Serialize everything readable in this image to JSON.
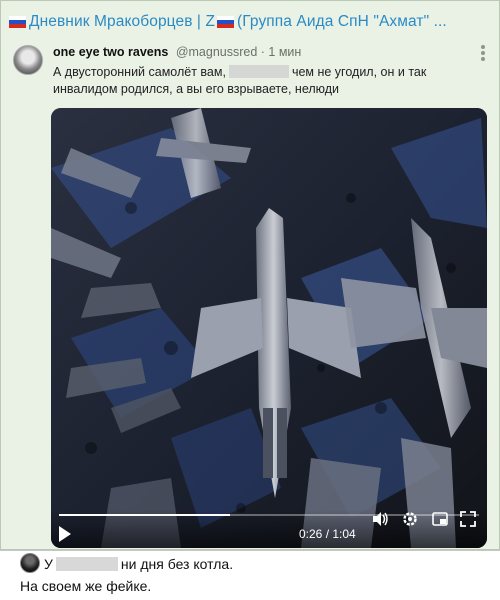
{
  "channel": {
    "title": "Дневник Мракоборцев | Z",
    "title_suffix": "(Группа Аида СпН \"Ахмат\" ..."
  },
  "tweet": {
    "author": "one eye two ravens",
    "handle_time": "@magnussred · 1 мин",
    "text_part1": "А двусторонний самолёт вам,",
    "text_part2": "чем не угодил, он и так инвалидом родился, а вы его взрываете, нелюди"
  },
  "video": {
    "time": "0:26 / 1:04",
    "progress": 0.406
  },
  "comment": {
    "line1_prefix": "У",
    "line1_suffix": "ни дня без котла.",
    "line2": "На своем же фейке."
  }
}
